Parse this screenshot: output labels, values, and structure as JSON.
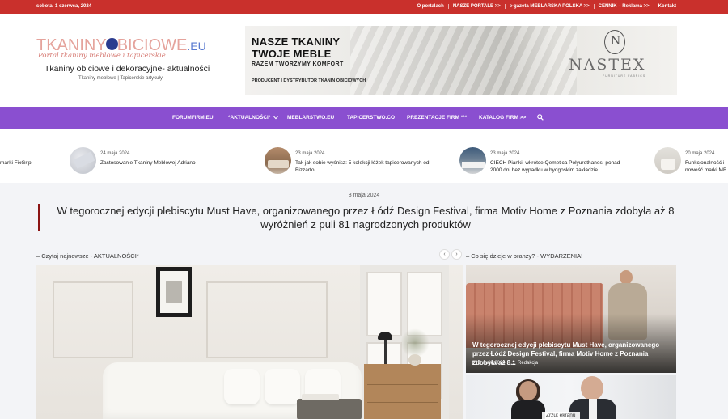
{
  "topbar": {
    "date": "sobota, 1 czerwca, 2024",
    "links": [
      "O portalach",
      "NASZE PORTALE >>",
      "e-gazeta MEBLARSKA POLSKA >>",
      "CENNIK – Reklama >>",
      "Kontakt"
    ]
  },
  "header": {
    "logo": {
      "wordmark_part1": "TKANINY",
      "wordmark_part2": "BICIOWE",
      "wordmark_tld": ".EU",
      "tagline": "Portal tkaniny meblowe i tapicerskie",
      "subtitle": "Tkaniny obiciowe i dekoracyjne- aktualności",
      "small": "Tkaniny meblowe | Tapicerskie artykuły"
    },
    "banner": {
      "line1": "NASZE TKANINY",
      "line2": "TWOJE MEBLE",
      "line3": "RAZEM TWORZYMY KOMFORT",
      "line4": "PRODUCENT I DYSTRYBUTOR TKANIN OBICIOWYCH",
      "brand": "NASTEX",
      "brand_sub": "FURNITURE FABRICS"
    }
  },
  "nav": {
    "items": [
      "FORUMFIRM.EU",
      "*AKTUALNOŚCI*",
      "MEBLARSTWO.EU",
      "TAPICERSTWO.CO",
      "PREZENTACJE FIRM ***",
      "KATALOG FIRM >>"
    ],
    "dropdown_icon": "chevron-down-icon",
    "search_icon": "search-icon"
  },
  "ticker": [
    {
      "date": "",
      "title": "marki FixGrip"
    },
    {
      "date": "24 maja 2024",
      "title": "Zastosowanie Tkaniny Meblowej Adriano"
    },
    {
      "date": "23 maja 2024",
      "title_l1": "Tak jak sobie wyśnisz: 5 kolekcji łóżek tapicerowanych od",
      "title_l2": "Bizzarto"
    },
    {
      "date": "23 maja 2024",
      "title_l1": "CIECH Pianki, wkrótce Qemetica Polyurethanes: ponad",
      "title_l2": "2000 dni bez wypadku w bydgoskim zakładzie..."
    },
    {
      "date": "20 maja 2024",
      "title_l1": "Funkcjonalność i",
      "title_l2": "nowość marki MB"
    }
  ],
  "featured": {
    "date": "8 maja 2024",
    "title": "W tegorocznej edycji plebiscytu Must Have, organizowanego przez Łódź Design Festival, firma Motiv Home z Poznania zdobyła aż 8 wyróżnień z puli 81 nagrodzonych produktów"
  },
  "sections": {
    "left": "– Czytaj najnowsze - AKTUALNOŚCI*",
    "right": "– Co się dzieje w branży? - WYDARZENIA!",
    "prev": "‹",
    "next": "›"
  },
  "card1": {
    "title": "W tegorocznej edycji plebiscytu Must Have, organizowanego przez Łódź Design Festival, firma Motiv Home z Poznania zdobyła aż 8...",
    "date": "8 maja 2024",
    "author": "Redakcja"
  },
  "card2": {
    "label": "Zrzut ekranu"
  },
  "colors": {
    "topbar": "#c9302c",
    "nav": "#8a4fd0",
    "accent_border": "#8b1414"
  }
}
